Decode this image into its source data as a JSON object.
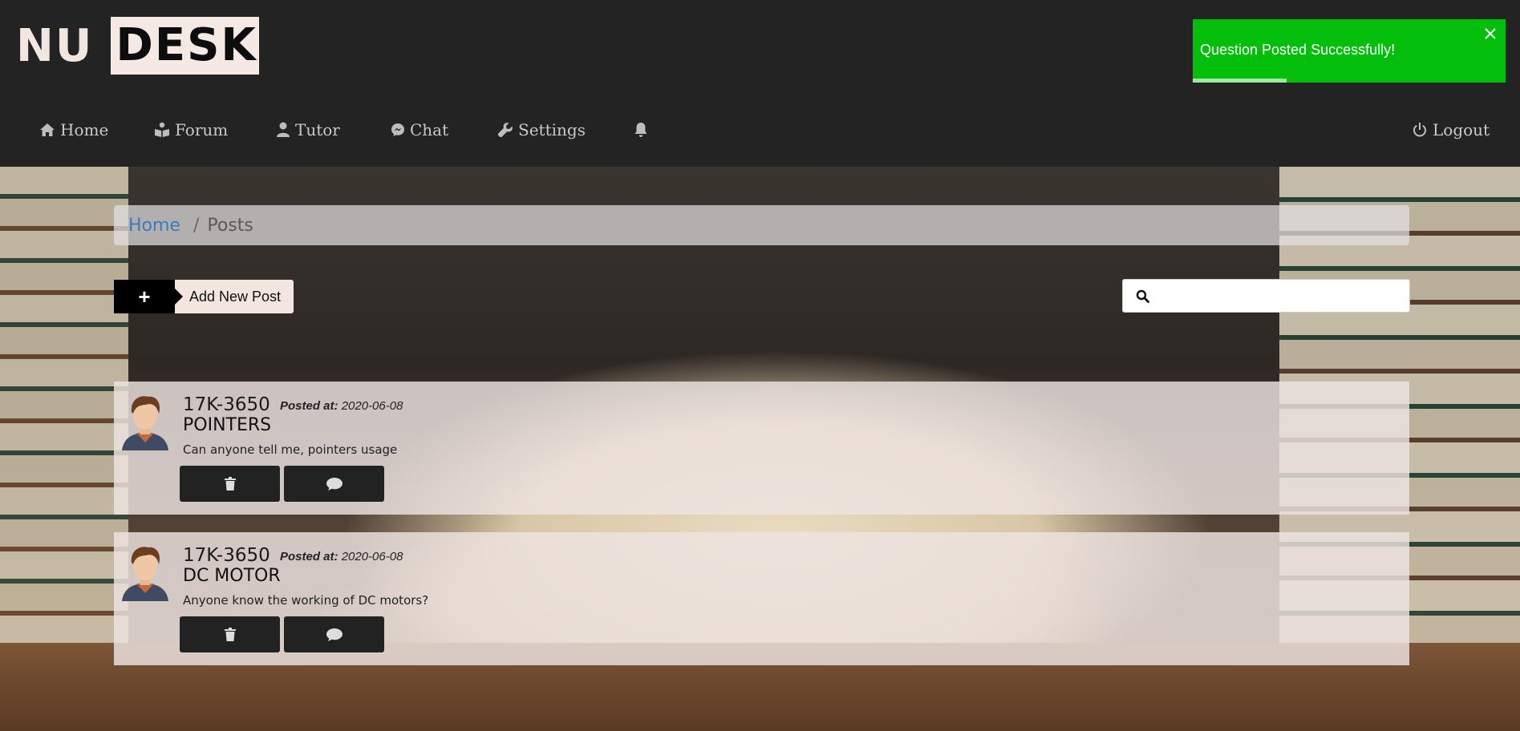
{
  "brand": {
    "part1": "NU",
    "part2": "DESK"
  },
  "nav": {
    "home": "Home",
    "forum": "Forum",
    "tutor": "Tutor",
    "chat": "Chat",
    "settings": "Settings",
    "logout": "Logout"
  },
  "toast": {
    "message": "Question Posted Successfully!",
    "progress_percent": 30
  },
  "breadcrumb": {
    "home": "Home",
    "separator": "/",
    "current": "Posts"
  },
  "add_post": {
    "icon": "+",
    "label": "Add New Post"
  },
  "search": {
    "placeholder": "",
    "value": ""
  },
  "posts": [
    {
      "user": "17K-3650",
      "posted_at_label": "Posted at:",
      "posted_at": "2020-06-08",
      "title": "POINTERS",
      "body": "Can anyone tell me, pointers usage"
    },
    {
      "user": "17K-3650",
      "posted_at_label": "Posted at:",
      "posted_at": "2020-06-08",
      "title": "DC MOTOR",
      "body": "Anyone know the working of DC motors?"
    }
  ],
  "colors": {
    "toast_bg": "#03bf0b",
    "header_bg": "#232323",
    "breadcrumb_link": "#3d7ab8"
  }
}
